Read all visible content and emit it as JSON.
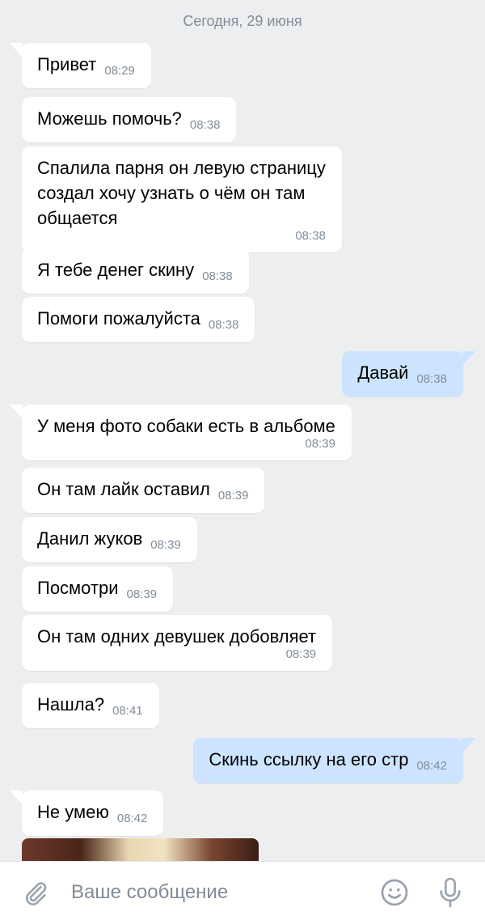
{
  "chat": {
    "date": "Сегодня, 29 июня",
    "messages": [
      {
        "text": "Привет",
        "time": "08:29"
      },
      {
        "text": "Можешь помочь?",
        "time": "08:38"
      },
      {
        "text_lines": [
          "Спалила парня он левую страницу",
          "создал хочу узнать о чём он там",
          "общается"
        ],
        "time": "08:38"
      },
      {
        "text": "Я тебе денег скину",
        "time": "08:38"
      },
      {
        "text": "Помоги пожалуйста",
        "time": "08:38"
      },
      {
        "text": "Давай",
        "time": "08:38"
      },
      {
        "text": "У меня фото собаки есть в альбоме",
        "time": "08:39"
      },
      {
        "text": "Он там лайк оставил",
        "time": "08:39"
      },
      {
        "text": "Данил жуков",
        "time": "08:39"
      },
      {
        "text": "Посмотри",
        "time": "08:39"
      },
      {
        "text": "Он там одних девушек добовляет",
        "time": "08:39"
      },
      {
        "text": "Нашла?",
        "time": "08:41"
      },
      {
        "text": "Скинь ссылку на его стр",
        "time": "08:42"
      },
      {
        "text": "Не умею",
        "time": "08:42"
      }
    ]
  },
  "composer": {
    "placeholder": "Ваше сообщение",
    "icons": [
      "attach-icon",
      "emoji-icon",
      "microphone-icon"
    ]
  },
  "colors": {
    "background": "#edeef0",
    "incoming_bubble": "#ffffff",
    "outgoing_bubble": "#cce4ff",
    "meta_text": "#818c99"
  }
}
